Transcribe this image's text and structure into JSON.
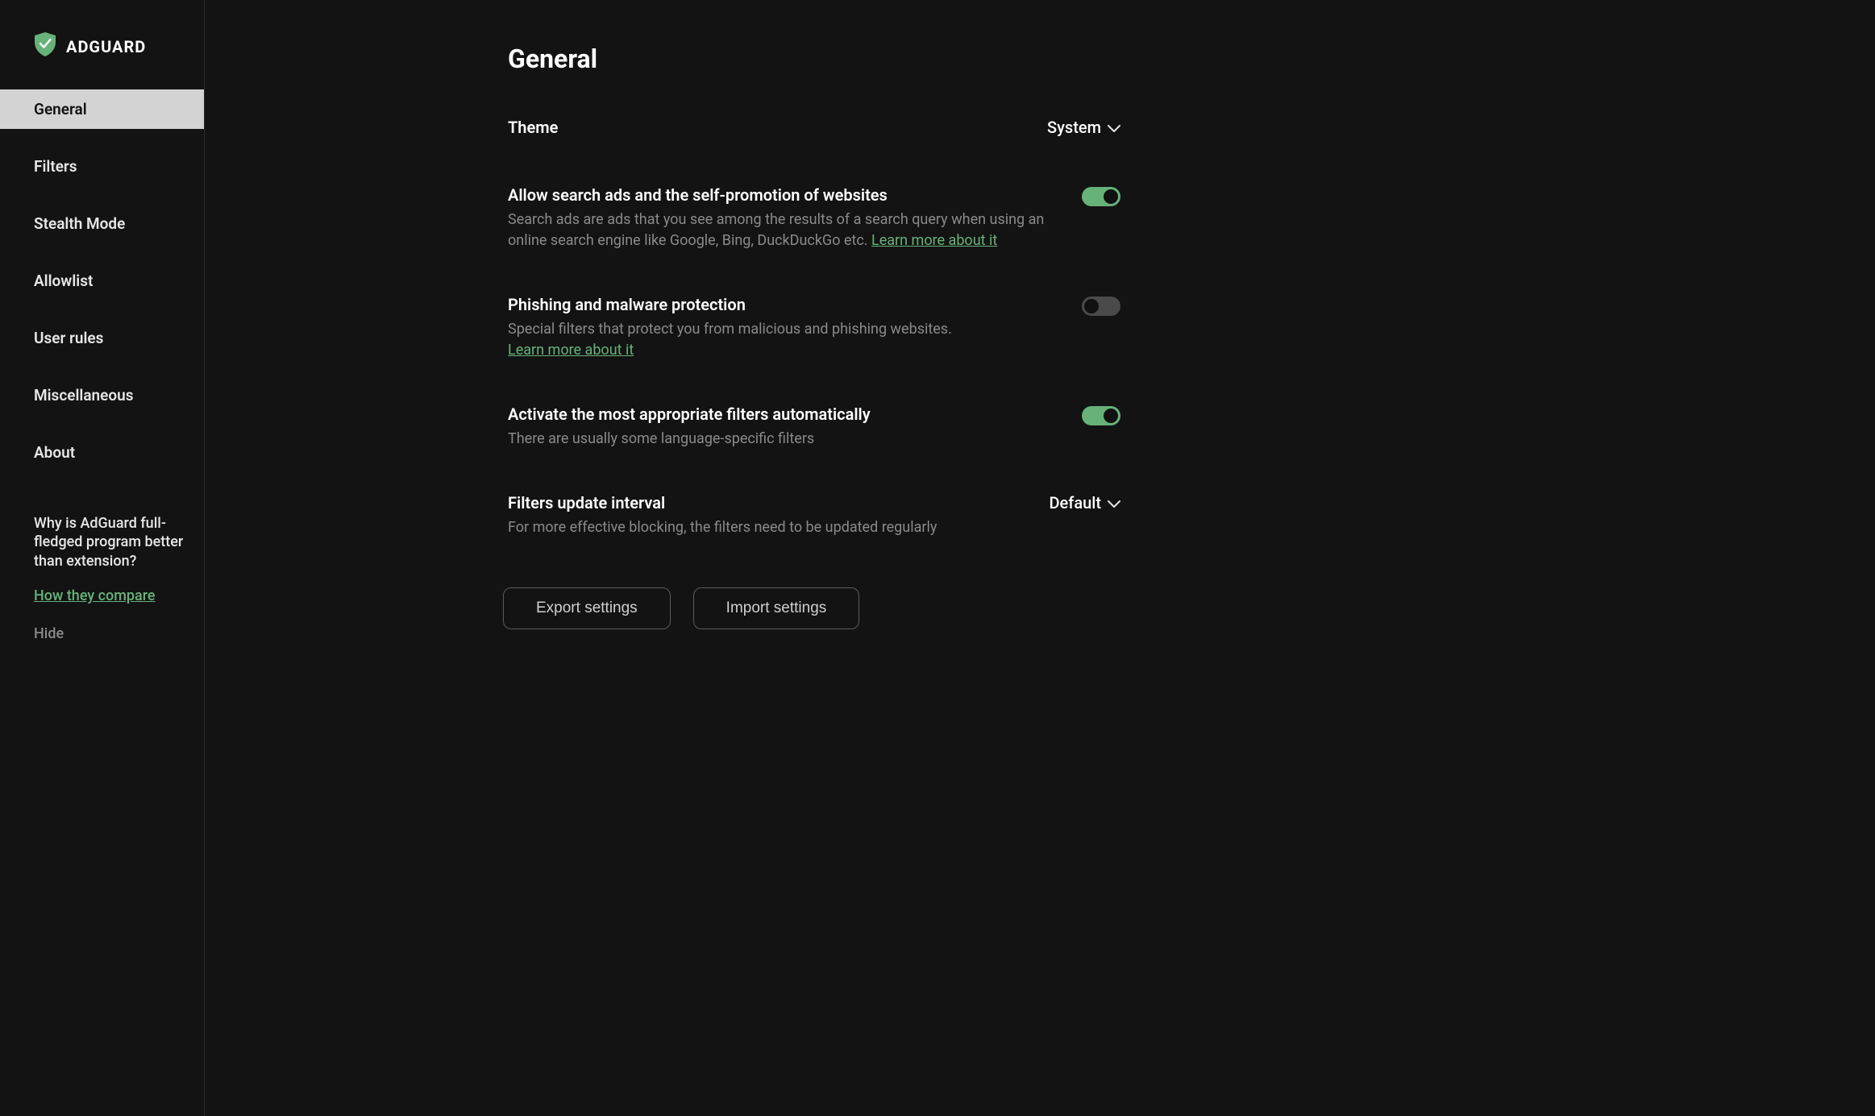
{
  "brand": "ADGUARD",
  "nav": {
    "items": [
      {
        "label": "General",
        "active": true
      },
      {
        "label": "Filters",
        "active": false
      },
      {
        "label": "Stealth Mode",
        "active": false
      },
      {
        "label": "Allowlist",
        "active": false
      },
      {
        "label": "User rules",
        "active": false
      },
      {
        "label": "Miscellaneous",
        "active": false
      },
      {
        "label": "About",
        "active": false
      }
    ]
  },
  "promo": {
    "text": "Why is AdGuard full-fledged program better than extension?",
    "link": "How they compare",
    "hide": "Hide"
  },
  "page": {
    "title": "General",
    "theme": {
      "label": "Theme",
      "value": "System"
    },
    "search_ads": {
      "title": "Allow search ads and the self-promotion of websites",
      "desc": "Search ads are ads that you see among the results of a search query when using an online search engine like Google, Bing, DuckDuckGo etc. ",
      "learn": "Learn more about it",
      "enabled": true
    },
    "phishing": {
      "title": "Phishing and malware protection",
      "desc": "Special filters that protect you from malicious and phishing websites.",
      "learn": "Learn more about it",
      "enabled": false
    },
    "auto_filters": {
      "title": "Activate the most appropriate filters automatically",
      "desc": "There are usually some language-specific filters",
      "enabled": true
    },
    "update_interval": {
      "title": "Filters update interval",
      "desc": "For more effective blocking, the filters need to be updated regularly",
      "value": "Default"
    },
    "buttons": {
      "export": "Export settings",
      "import": "Import settings"
    }
  }
}
